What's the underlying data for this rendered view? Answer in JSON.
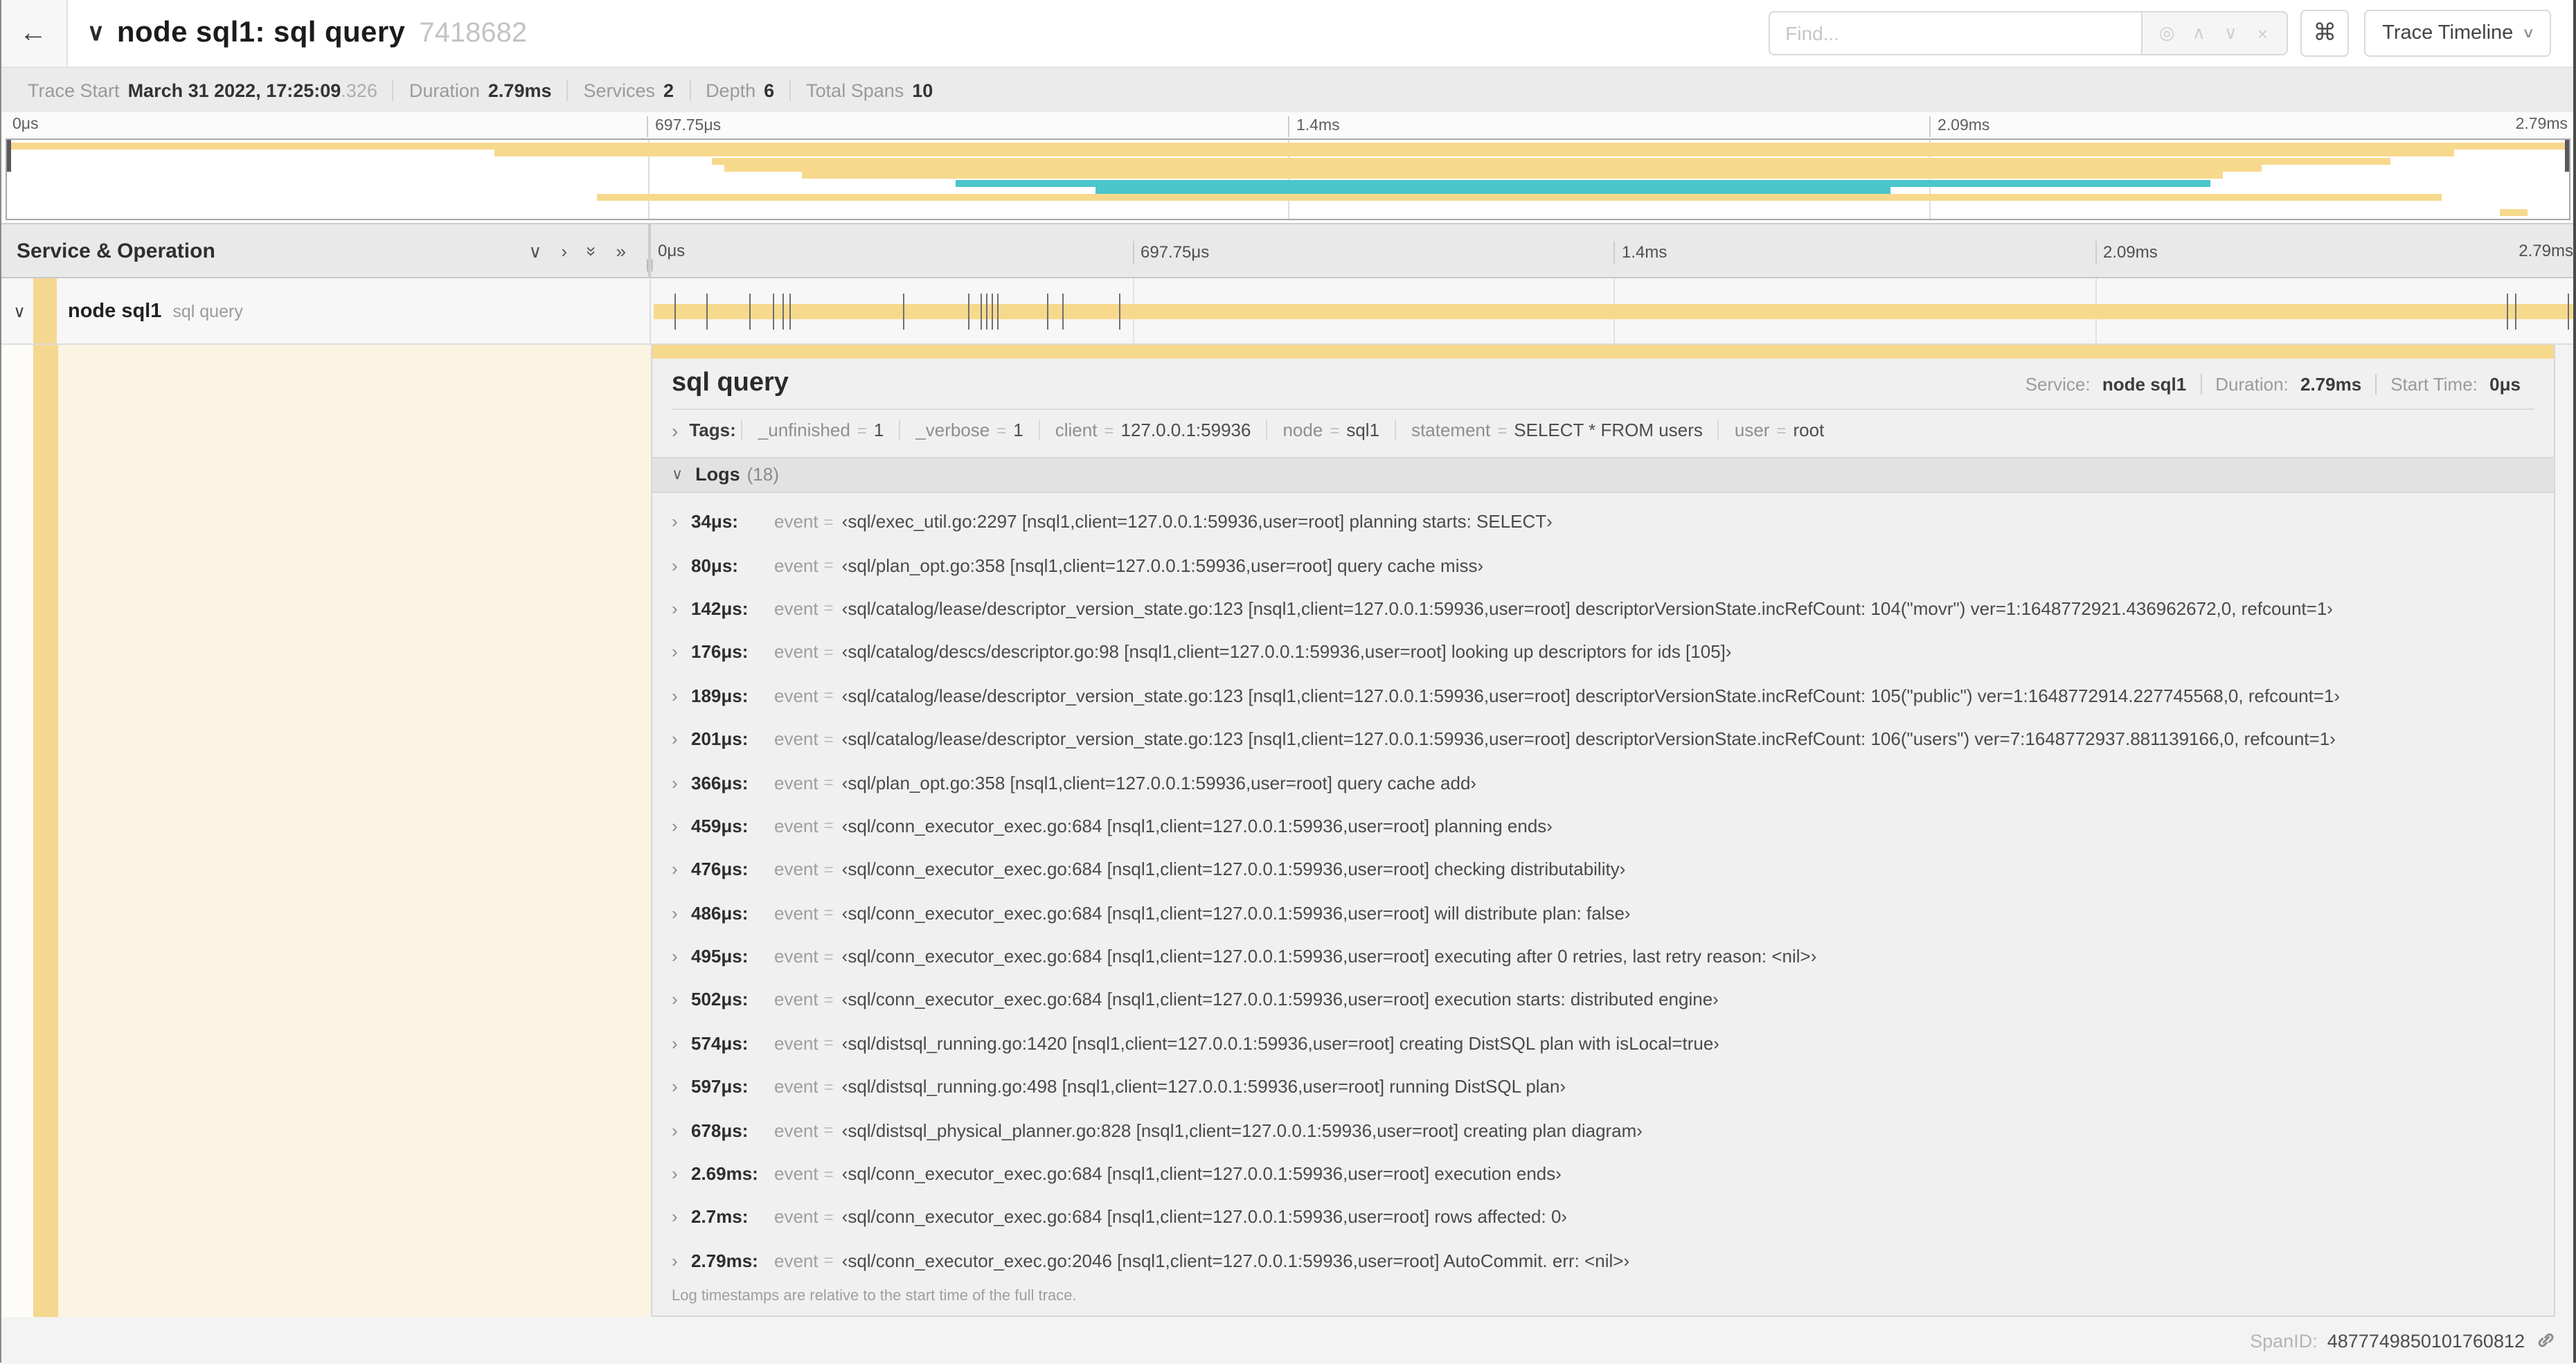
{
  "header": {
    "title": "node sql1: sql query",
    "trace_id_short": "7418682",
    "find_placeholder": "Find...",
    "view_selector_label": "Trace Timeline"
  },
  "icons": {
    "back": "←",
    "collapse_chevron": "∨",
    "locate": "◎",
    "prev": "∧",
    "next": "∨",
    "clear": "×",
    "cmd": "⌘",
    "collapse_one": "∨",
    "expand_one": "›",
    "collapse_all": "»",
    "expand_all": "»",
    "tags_chevron": "›",
    "logs_chevron": "∨",
    "log_row_chevron": "›",
    "view_chevron": "∨",
    "grip": "||"
  },
  "trace_info": {
    "items": [
      {
        "label": "Trace Start",
        "value": "March 31 2022, 17:25:09",
        "suffix": ".326"
      },
      {
        "label": "Duration",
        "value": "2.79ms",
        "suffix": ""
      },
      {
        "label": "Services",
        "value": "2",
        "suffix": ""
      },
      {
        "label": "Depth",
        "value": "6",
        "suffix": ""
      },
      {
        "label": "Total Spans",
        "value": "10",
        "suffix": ""
      }
    ]
  },
  "minimap": {
    "ticks": [
      "0μs",
      "697.75μs",
      "1.4ms",
      "2.09ms",
      "2.79ms"
    ],
    "colors": {
      "yellow": "#F7D98D",
      "teal": "#4AC5C9"
    },
    "spans": [
      {
        "row": 0,
        "start": 0,
        "end": 100,
        "color": "yellow"
      },
      {
        "row": 1,
        "start": 19,
        "end": 95.5,
        "color": "yellow"
      },
      {
        "row": 2,
        "start": 27.5,
        "end": 93,
        "color": "yellow"
      },
      {
        "row": 3,
        "start": 28,
        "end": 88,
        "color": "yellow"
      },
      {
        "row": 4,
        "start": 31,
        "end": 86.5,
        "color": "yellow"
      },
      {
        "row": 5,
        "start": 37,
        "end": 86,
        "color": "teal"
      },
      {
        "row": 6,
        "start": 42.5,
        "end": 73.5,
        "color": "teal"
      },
      {
        "row": 7,
        "start": 23,
        "end": 95,
        "color": "yellow"
      },
      {
        "row": 9,
        "start": 97.3,
        "end": 98.4,
        "color": "yellow"
      }
    ]
  },
  "timeline_header": {
    "left_title": "Service & Operation",
    "ruler_ticks": [
      "0μs",
      "697.75μs",
      "1.4ms",
      "2.09ms",
      "2.79ms"
    ]
  },
  "span_row": {
    "service": "node sql1",
    "operation": "sql query",
    "bar_color": "#F7D98D",
    "log_marker_pcts": [
      1.2,
      2.9,
      5.1,
      6.3,
      6.8,
      7.2,
      13.1,
      16.5,
      17.1,
      17.4,
      17.7,
      18.0,
      20.6,
      21.4,
      24.3,
      96.4,
      96.8,
      99.6
    ]
  },
  "detail": {
    "title": "sql query",
    "meta": [
      {
        "label": "Service:",
        "value": "node sql1"
      },
      {
        "label": "Duration:",
        "value": "2.79ms"
      },
      {
        "label": "Start Time:",
        "value": "0μs"
      }
    ],
    "tags_label": "Tags:",
    "tags": [
      {
        "key": "_unfinished",
        "value": "1"
      },
      {
        "key": "_verbose",
        "value": "1"
      },
      {
        "key": "client",
        "value": "127.0.0.1:59936"
      },
      {
        "key": "node",
        "value": "sql1"
      },
      {
        "key": "statement",
        "value": "SELECT * FROM users"
      },
      {
        "key": "user",
        "value": "root"
      }
    ],
    "logs_label": "Logs",
    "logs_count": "(18)",
    "logs": [
      {
        "time": "34μs:",
        "field": "event",
        "value": "‹sql/exec_util.go:2297 [nsql1,client=127.0.0.1:59936,user=root] planning starts: SELECT›"
      },
      {
        "time": "80μs:",
        "field": "event",
        "value": "‹sql/plan_opt.go:358 [nsql1,client=127.0.0.1:59936,user=root] query cache miss›"
      },
      {
        "time": "142μs:",
        "field": "event",
        "value": "‹sql/catalog/lease/descriptor_version_state.go:123 [nsql1,client=127.0.0.1:59936,user=root] descriptorVersionState.incRefCount: 104(\"movr\") ver=1:1648772921.436962672,0, refcount=1›"
      },
      {
        "time": "176μs:",
        "field": "event",
        "value": "‹sql/catalog/descs/descriptor.go:98 [nsql1,client=127.0.0.1:59936,user=root] looking up descriptors for ids [105]›"
      },
      {
        "time": "189μs:",
        "field": "event",
        "value": "‹sql/catalog/lease/descriptor_version_state.go:123 [nsql1,client=127.0.0.1:59936,user=root] descriptorVersionState.incRefCount: 105(\"public\") ver=1:1648772914.227745568,0, refcount=1›"
      },
      {
        "time": "201μs:",
        "field": "event",
        "value": "‹sql/catalog/lease/descriptor_version_state.go:123 [nsql1,client=127.0.0.1:59936,user=root] descriptorVersionState.incRefCount: 106(\"users\") ver=7:1648772937.881139166,0, refcount=1›"
      },
      {
        "time": "366μs:",
        "field": "event",
        "value": "‹sql/plan_opt.go:358 [nsql1,client=127.0.0.1:59936,user=root] query cache add›"
      },
      {
        "time": "459μs:",
        "field": "event",
        "value": "‹sql/conn_executor_exec.go:684 [nsql1,client=127.0.0.1:59936,user=root] planning ends›"
      },
      {
        "time": "476μs:",
        "field": "event",
        "value": "‹sql/conn_executor_exec.go:684 [nsql1,client=127.0.0.1:59936,user=root] checking distributability›"
      },
      {
        "time": "486μs:",
        "field": "event",
        "value": "‹sql/conn_executor_exec.go:684 [nsql1,client=127.0.0.1:59936,user=root] will distribute plan: false›"
      },
      {
        "time": "495μs:",
        "field": "event",
        "value": "‹sql/conn_executor_exec.go:684 [nsql1,client=127.0.0.1:59936,user=root] executing after 0 retries, last retry reason: <nil>›"
      },
      {
        "time": "502μs:",
        "field": "event",
        "value": "‹sql/conn_executor_exec.go:684 [nsql1,client=127.0.0.1:59936,user=root] execution starts: distributed engine›"
      },
      {
        "time": "574μs:",
        "field": "event",
        "value": "‹sql/distsql_running.go:1420 [nsql1,client=127.0.0.1:59936,user=root] creating DistSQL plan with isLocal=true›"
      },
      {
        "time": "597μs:",
        "field": "event",
        "value": "‹sql/distsql_running.go:498 [nsql1,client=127.0.0.1:59936,user=root] running DistSQL plan›"
      },
      {
        "time": "678μs:",
        "field": "event",
        "value": "‹sql/distsql_physical_planner.go:828 [nsql1,client=127.0.0.1:59936,user=root] creating plan diagram›"
      },
      {
        "time": "2.69ms:",
        "field": "event",
        "value": "‹sql/conn_executor_exec.go:684 [nsql1,client=127.0.0.1:59936,user=root] execution ends›"
      },
      {
        "time": "2.7ms:",
        "field": "event",
        "value": "‹sql/conn_executor_exec.go:684 [nsql1,client=127.0.0.1:59936,user=root] rows affected: 0›"
      },
      {
        "time": "2.79ms:",
        "field": "event",
        "value": "‹sql/conn_executor_exec.go:2046 [nsql1,client=127.0.0.1:59936,user=root] AutoCommit. err: <nil>›"
      }
    ],
    "footer_note": "Log timestamps are relative to the start time of the full trace.",
    "span_id_label": "SpanID:",
    "span_id": "4877749850101760812"
  }
}
